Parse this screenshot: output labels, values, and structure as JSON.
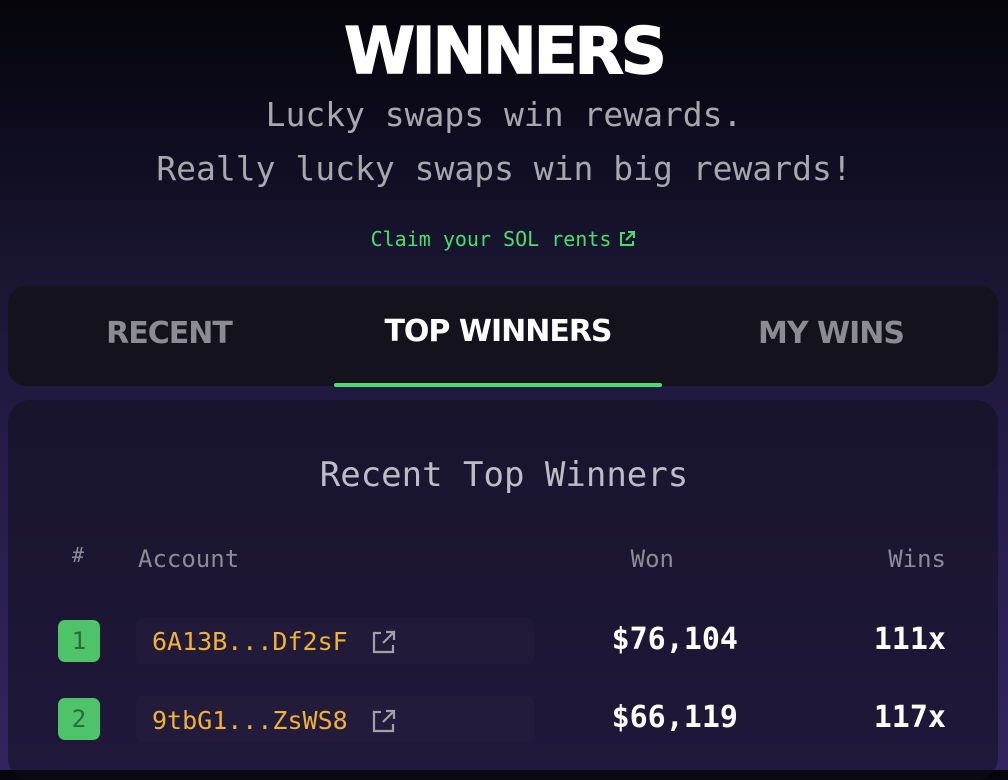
{
  "header": {
    "title": "WINNERS",
    "subtitle_line1": "Lucky swaps win rewards.",
    "subtitle_line2": "Really lucky swaps win big rewards!",
    "claim_link": "Claim your SOL rents"
  },
  "tabs": [
    {
      "label": "RECENT",
      "active": false
    },
    {
      "label": "TOP WINNERS",
      "active": true
    },
    {
      "label": "MY WINS",
      "active": false
    }
  ],
  "leaderboard": {
    "title": "Recent Top Winners",
    "columns": {
      "rank": "#",
      "account": "Account",
      "won": "Won",
      "wins": "Wins"
    },
    "rows": [
      {
        "rank": "1",
        "account": "6A13B...Df2sF",
        "won": "$76,104",
        "wins": "111x"
      },
      {
        "rank": "2",
        "account": "9tbG1...ZsWS8",
        "won": "$66,119",
        "wins": "117x"
      }
    ]
  },
  "colors": {
    "accent_green": "#4ade6a",
    "account_gold": "#f2b233",
    "rank_badge": "#4fc36a"
  },
  "icons": {
    "external_link": "external-link-icon"
  }
}
